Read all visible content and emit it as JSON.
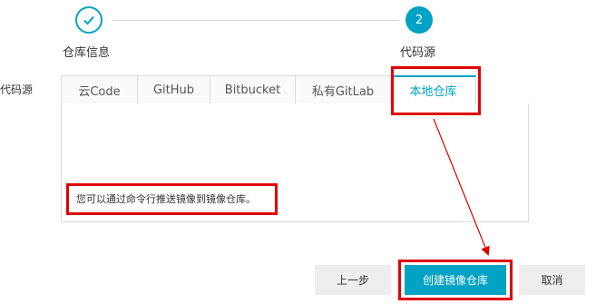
{
  "steps": [
    {
      "label": "仓库信息",
      "status": "done"
    },
    {
      "label": "代码源",
      "number": "2",
      "status": "active"
    }
  ],
  "field_label": "代码源",
  "tabs": [
    {
      "label": "云Code"
    },
    {
      "label": "GitHub"
    },
    {
      "label": "Bitbucket"
    },
    {
      "label": "私有GitLab"
    },
    {
      "label": "本地仓库",
      "active": true
    }
  ],
  "panel": {
    "message": "您可以通过命令行推送镜像到镜像仓库。"
  },
  "buttons": {
    "prev": "上一步",
    "create": "创建镜像仓库",
    "cancel": "取消"
  },
  "colors": {
    "accent": "#00a3c4",
    "highlight": "#e00000"
  },
  "icons": {
    "done_step": "checkmark-icon"
  }
}
